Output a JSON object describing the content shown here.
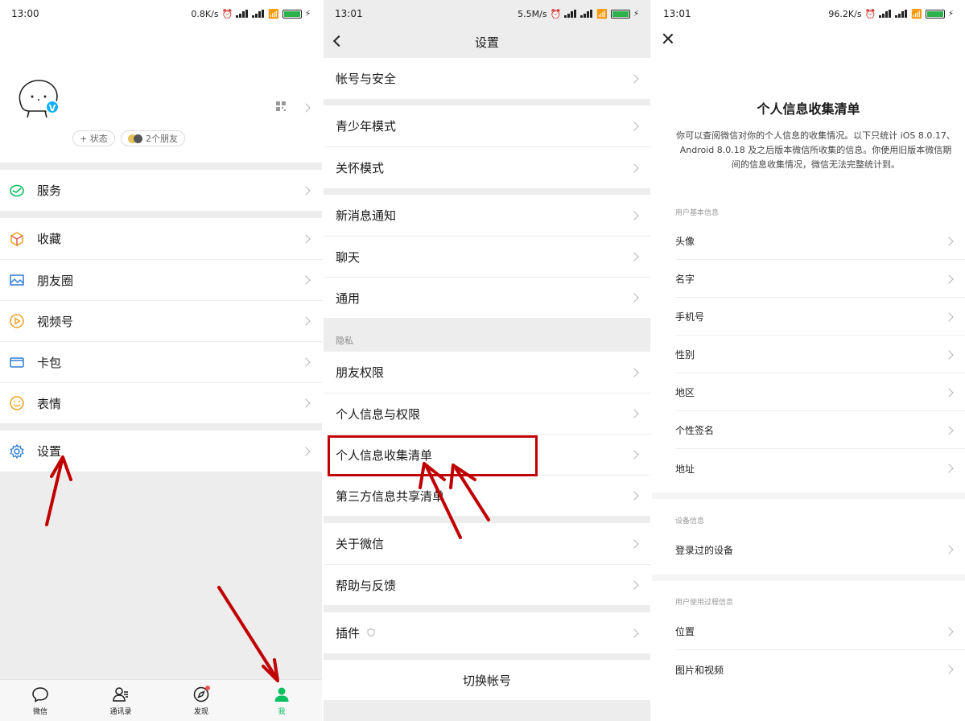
{
  "colors": {
    "accent_green": "#07c160",
    "annotation_red": "#c00000",
    "badge_blue": "#10aeff"
  },
  "panel1": {
    "status": {
      "time": "13:00",
      "speed": "0.8K/s",
      "battery": "100"
    },
    "profile": {
      "badge": "V",
      "status_chip": "+ 状态",
      "friends_chip": "2个朋友"
    },
    "menu": [
      {
        "label": "服务",
        "icon": "wallet-icon"
      },
      {
        "label": "收藏",
        "icon": "cube-icon"
      },
      {
        "label": "朋友圈",
        "icon": "image-icon"
      },
      {
        "label": "视频号",
        "icon": "play-icon"
      },
      {
        "label": "卡包",
        "icon": "card-icon"
      },
      {
        "label": "表情",
        "icon": "smile-icon"
      },
      {
        "label": "设置",
        "icon": "gear-icon"
      }
    ],
    "tabs": [
      {
        "label": "微信",
        "icon": "chat-icon"
      },
      {
        "label": "通讯录",
        "icon": "contacts-icon"
      },
      {
        "label": "发现",
        "icon": "compass-icon"
      },
      {
        "label": "我",
        "icon": "person-icon"
      }
    ]
  },
  "panel2": {
    "status": {
      "time": "13:01",
      "speed": "5.5M/s",
      "battery": "100"
    },
    "title": "设置",
    "items": {
      "account": "帐号与安全",
      "teen": "青少年模式",
      "care": "关怀模式",
      "notify": "新消息通知",
      "chat": "聊天",
      "general": "通用",
      "privacy_section": "隐私",
      "friend_perm": "朋友权限",
      "personal_perm": "个人信息与权限",
      "collect_list": "个人信息收集清单",
      "third_party": "第三方信息共享清单",
      "about": "关于微信",
      "help": "帮助与反馈",
      "plugins": "插件",
      "switch": "切换帐号"
    }
  },
  "panel3": {
    "status": {
      "time": "13:01",
      "speed": "96.2K/s",
      "battery": "100"
    },
    "title": "个人信息收集清单",
    "description": "你可以查阅微信对你的个人信息的收集情况。以下只统计 iOS 8.0.17、Android 8.0.18 及之后版本微信所收集的信息。你使用旧版本微信期间的信息收集情况，微信无法完整统计到。",
    "section_basic": "用户基本信息",
    "basic_items": [
      "头像",
      "名字",
      "手机号",
      "性别",
      "地区",
      "个性签名",
      "地址"
    ],
    "section_device": "设备信息",
    "device_items": [
      "登录过的设备"
    ],
    "section_usage": "用户使用过程信息",
    "usage_items": [
      "位置",
      "图片和视频"
    ]
  }
}
